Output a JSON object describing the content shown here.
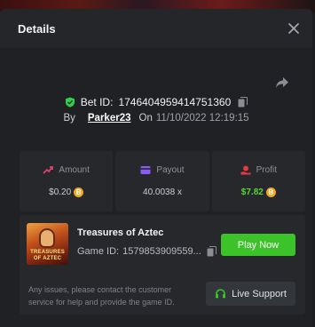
{
  "header": {
    "title": "Details"
  },
  "bet": {
    "id_label": "Bet ID:",
    "id_value": "1746404959414751360",
    "by_label": "By",
    "username": "Parker23",
    "on_label": "On",
    "date": "11/10/2022 12:19:15"
  },
  "stats": [
    {
      "label": "Amount",
      "value": "$0.20",
      "icon": "amount-icon",
      "color": "#e0436b",
      "coin": true
    },
    {
      "label": "Payout",
      "value": "40.0038 x",
      "icon": "payout-icon",
      "color": "#8a5cf5",
      "coin": false
    },
    {
      "label": "Profit",
      "value": "$7.82",
      "icon": "profit-icon",
      "color": "#e8383f",
      "coin": true
    }
  ],
  "game": {
    "thumbnail_text": "TREASURES OF AZTEC",
    "name": "Treasures of Aztec",
    "id_label": "Game ID:",
    "id_value": "1579853909559...",
    "play_label": "Play Now"
  },
  "support": {
    "help_text": "Any issues, please contact the customer service for help and provide the game ID.",
    "button_label": "Live Support"
  },
  "coin_symbol": "B",
  "colors": {
    "accent_green": "#3dc32a",
    "profit_green": "#54d63c",
    "coin": "#f5a623",
    "shield": "#2fd14a"
  }
}
